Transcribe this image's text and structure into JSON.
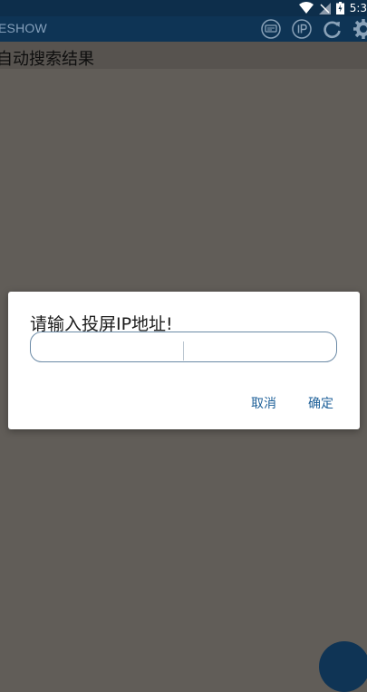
{
  "status_bar": {
    "time": "5:3"
  },
  "toolbar": {
    "title": "ESHOW",
    "actions": [
      "cast-icon",
      "ip-icon",
      "refresh-icon",
      "settings-icon"
    ]
  },
  "section_header": {
    "text": "自动搜索结果"
  },
  "dialog": {
    "title": "请输入投屏IP地址!",
    "input": {
      "value": "",
      "placeholder": ""
    },
    "cancel_label": "取消",
    "ok_label": "确定"
  },
  "colors": {
    "toolbar": "#0e3455",
    "scrim": "#615d58",
    "accent": "#1c5f98"
  }
}
